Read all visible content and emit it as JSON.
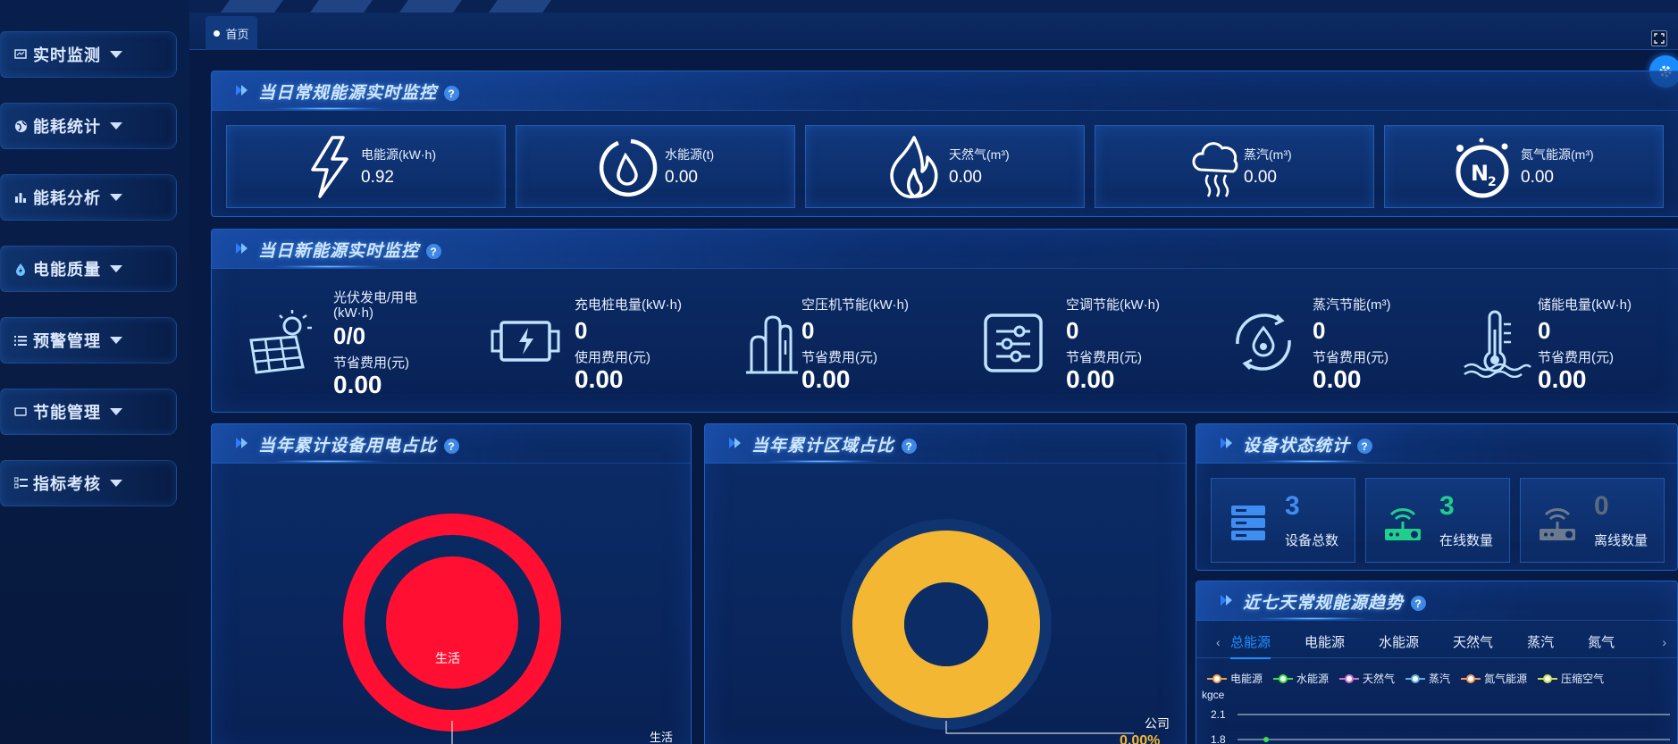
{
  "sidebar": {
    "items": [
      {
        "label": "实时监测",
        "icon": "monitor-icon"
      },
      {
        "label": "能耗统计",
        "icon": "globe-icon"
      },
      {
        "label": "能耗分析",
        "icon": "bar-chart-icon"
      },
      {
        "label": "电能质量",
        "icon": "bolt-drop-icon"
      },
      {
        "label": "预警管理",
        "icon": "list-icon"
      },
      {
        "label": "节能管理",
        "icon": "rectangle-icon"
      },
      {
        "label": "指标考核",
        "icon": "checklist-icon"
      }
    ]
  },
  "tabs": {
    "home": "首页"
  },
  "conventional": {
    "title": "当日常规能源实时监控",
    "cards": [
      {
        "label": "电能源(kW·h)",
        "value": "0.92",
        "icon": "lightning-icon"
      },
      {
        "label": "水能源(t)",
        "value": "0.00",
        "icon": "water-drop-icon"
      },
      {
        "label": "天然气(m³)",
        "value": "0.00",
        "icon": "flame-icon"
      },
      {
        "label": "蒸汽(m³)",
        "value": "0.00",
        "icon": "steam-cloud-icon"
      },
      {
        "label": "氮气能源(m³)",
        "value": "0.00",
        "icon": "n2-icon"
      }
    ]
  },
  "new_energy": {
    "title": "当日新能源实时监控",
    "items": [
      {
        "label1": "光伏发电/用电 (kW·h)",
        "value1": "0/0",
        "label2": "节省费用(元)",
        "value2": "0.00",
        "icon": "solar-panel-icon"
      },
      {
        "label1": "充电桩电量(kW·h)",
        "value1": "0",
        "label2": "使用费用(元)",
        "value2": "0.00",
        "icon": "charger-icon"
      },
      {
        "label1": "空压机节能(kW·h)",
        "value1": "0",
        "label2": "节省费用(元)",
        "value2": "0.00",
        "icon": "compressor-icon"
      },
      {
        "label1": "空调节能(kW·h)",
        "value1": "0",
        "label2": "节省费用(元)",
        "value2": "0.00",
        "icon": "ac-controls-icon"
      },
      {
        "label1": "蒸汽节能(m³)",
        "value1": "0",
        "label2": "节省费用(元)",
        "value2": "0.00",
        "icon": "steam-saving-icon"
      },
      {
        "label1": "储能电量(kW·h)",
        "value1": "0",
        "label2": "节省费用(元)",
        "value2": "0.00",
        "icon": "thermometer-icon"
      }
    ]
  },
  "device_ratio": {
    "title": "当年累计设备用电占比",
    "center_label": "生活",
    "callout_label": "生活",
    "ring_color": "#ff1032"
  },
  "region_ratio": {
    "title": "当年累计区域占比",
    "callout_label": "公司",
    "callout_value": "0.00%",
    "ring_color": "#f4b733"
  },
  "device_status": {
    "title": "设备状态统计",
    "cards": [
      {
        "num": "3",
        "label": "设备总数",
        "color": "#3f8df0",
        "icon": "server-icon"
      },
      {
        "num": "3",
        "label": "在线数量",
        "color": "#1fcf8a",
        "icon": "router-online-icon"
      },
      {
        "num": "0",
        "label": "离线数量",
        "color": "#6b7a8e",
        "icon": "router-offline-icon"
      }
    ]
  },
  "trend": {
    "title": "近七天常规能源趋势",
    "tabs": [
      "总能源",
      "电能源",
      "水能源",
      "天然气",
      "蒸汽",
      "氮气"
    ],
    "legend": [
      {
        "name": "电能源",
        "color": "#f0a050"
      },
      {
        "name": "水能源",
        "color": "#3ee04a"
      },
      {
        "name": "天然气",
        "color": "#d070d0"
      },
      {
        "name": "蒸汽",
        "color": "#60b0d8"
      },
      {
        "name": "氮气能源",
        "color": "#f09860"
      },
      {
        "name": "压缩空气",
        "color": "#c8e050"
      }
    ],
    "unit": "kgce",
    "y_ticks": [
      "2.1",
      "1.8"
    ]
  }
}
